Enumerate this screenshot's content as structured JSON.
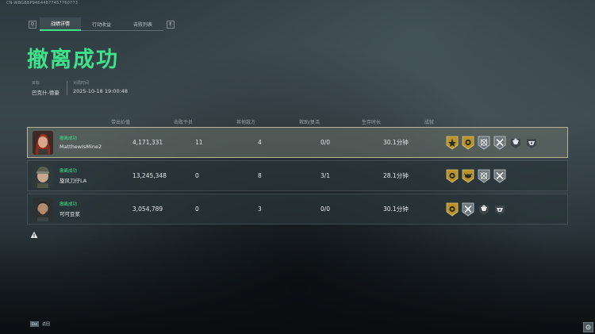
{
  "id_line": "CN-WBGBBP94644877457760773",
  "tabs": {
    "left_key": "Q",
    "right_key": "E",
    "items": [
      "战绩详情",
      "行动收益",
      "击败列表"
    ],
    "active_index": 0
  },
  "title": "撤离成功",
  "info": {
    "target_label": "目标",
    "target_value": "巴克什-德豪",
    "time_label": "对局时间",
    "time_value": "2025-10-18 19:00:48"
  },
  "table": {
    "headers": [
      "带出价值",
      "击败干员",
      "其他敌方",
      "救助/复活",
      "生存时长",
      "成就"
    ],
    "rows": [
      {
        "status": "撤离成功",
        "name": "MatthewIsMine2",
        "value": "4,171,331",
        "kills": "11",
        "other": "4",
        "assist": "0/0",
        "time": "30.1分钟",
        "achievements": [
          "gold-star-badge-icon",
          "gold-sun-badge-icon",
          "silver-target-badge-icon",
          "silver-crossed-badge-icon",
          "silver-gem-badge-icon",
          "silver-shield-badge-icon"
        ],
        "highlight": true,
        "avatar": "female-red-hair"
      },
      {
        "status": "撤离成功",
        "name": "旋风刀仔LA",
        "value": "13,245,348",
        "kills": "0",
        "other": "8",
        "assist": "3/1",
        "time": "28.1分钟",
        "achievements": [
          "gold-sun-badge-icon",
          "gold-crab-badge-icon",
          "silver-target-badge-icon",
          "silver-crossed-badge-icon"
        ],
        "highlight": false,
        "avatar": "female-goggles"
      },
      {
        "status": "撤离成功",
        "name": "可可豆浆",
        "value": "3,054,789",
        "kills": "0",
        "other": "3",
        "assist": "0/0",
        "time": "30.1分钟",
        "achievements": [
          "gold-sun-badge-icon",
          "silver-crossed-badge-icon",
          "silver-gem-badge-icon",
          "silver-shield-badge-icon"
        ],
        "highlight": false,
        "avatar": "male-beard"
      }
    ]
  },
  "bottom": {
    "key": "Esc",
    "label": "返回"
  },
  "colors": {
    "accent": "#3ee28a",
    "highlight_border": "#b7b29a",
    "gold": "#c9a43a"
  }
}
